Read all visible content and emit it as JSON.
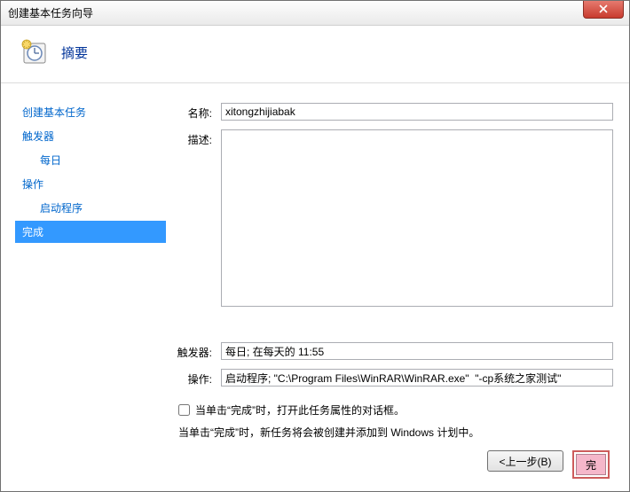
{
  "window": {
    "title": "创建基本任务向导"
  },
  "header": {
    "title": "摘要"
  },
  "sidebar": {
    "items": [
      {
        "label": "创建基本任务",
        "indent": false,
        "selected": false
      },
      {
        "label": "触发器",
        "indent": false,
        "selected": false
      },
      {
        "label": "每日",
        "indent": true,
        "selected": false
      },
      {
        "label": "操作",
        "indent": false,
        "selected": false
      },
      {
        "label": "启动程序",
        "indent": true,
        "selected": false
      },
      {
        "label": "完成",
        "indent": false,
        "selected": true
      }
    ]
  },
  "form": {
    "name_label": "名称:",
    "name_value": "xitongzhijiabak",
    "desc_label": "描述:",
    "desc_value": "",
    "trigger_label": "触发器:",
    "trigger_value": "每日; 在每天的 11:55",
    "action_label": "操作:",
    "action_value": "启动程序; \"C:\\Program Files\\WinRAR\\WinRAR.exe\"  \"-cp系统之家测试\"",
    "checkbox_label": "当单击“完成”时，打开此任务属性的对话框。",
    "info_text": "当单击“完成”时，新任务将会被创建并添加到 Windows 计划中。"
  },
  "footer": {
    "back_label": "<上一步(B)",
    "finish_label": "完"
  }
}
